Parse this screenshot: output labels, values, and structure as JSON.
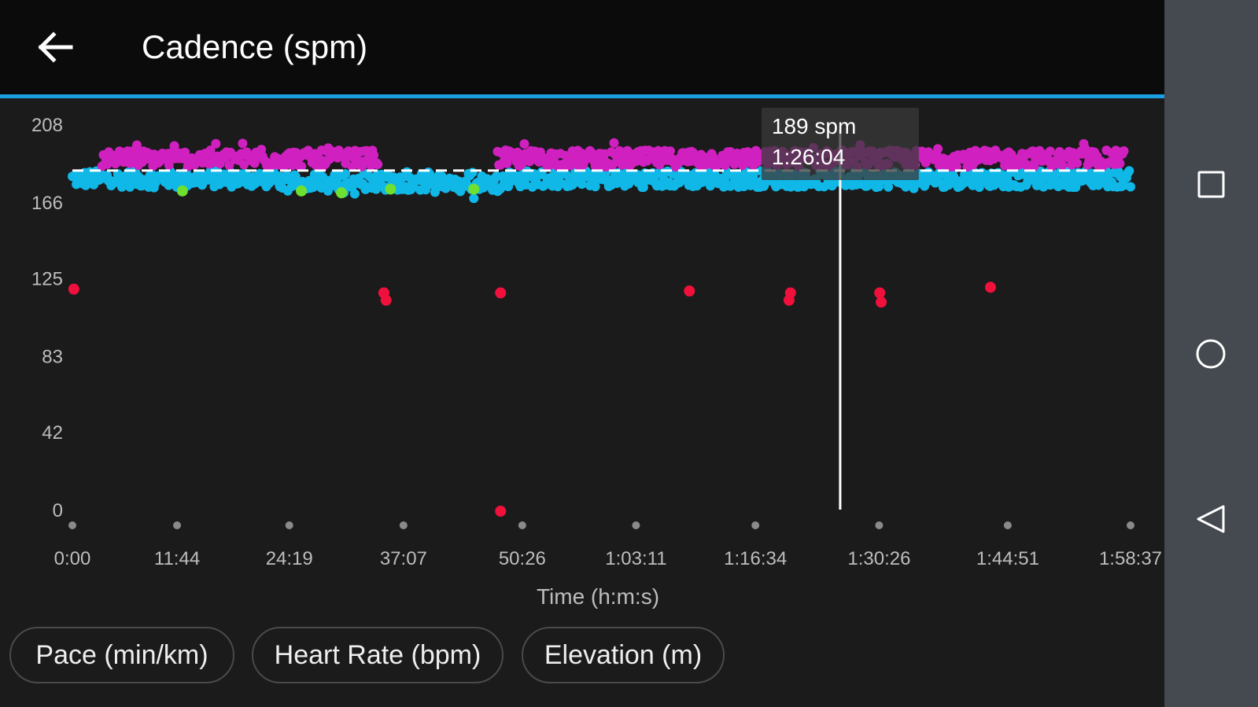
{
  "header": {
    "title": "Cadence (spm)",
    "back_icon": "arrow-left-icon"
  },
  "tooltip": {
    "value": "189 spm",
    "time": "1:26:04"
  },
  "buttons": [
    {
      "label": "Pace (min/km)"
    },
    {
      "label": "Heart Rate (bpm)"
    },
    {
      "label": "Elevation (m)"
    }
  ],
  "nav": {
    "recent_icon": "square-icon",
    "home_icon": "circle-icon",
    "back_icon": "triangle-back-icon",
    "background": "#444a4f"
  },
  "colors": {
    "header_bg": "#0b0b0b",
    "accent": "#1aa0e0",
    "magenta": "#d020c0",
    "cyan": "#10b8e8",
    "green": "#70e030",
    "red": "#f0103c"
  },
  "chart_data": {
    "type": "scatter",
    "title": "",
    "xlabel": "Time (h:m:s)",
    "ylabel": "",
    "xlim": [
      0,
      7117
    ],
    "ylim": [
      0,
      208
    ],
    "y_ticks": [
      208,
      166,
      125,
      83,
      42,
      0
    ],
    "x_ticks": [
      "0:00",
      "11:44",
      "24:19",
      "37:07",
      "50:26",
      "1:03:11",
      "1:16:34",
      "1:30:26",
      "1:44:51",
      "1:58:37"
    ],
    "x_tick_seconds": [
      0,
      704,
      1459,
      2227,
      3026,
      3791,
      4594,
      5426,
      6291,
      7117
    ],
    "average_line": 183,
    "cursor_time_seconds": 5164,
    "series": [
      {
        "color": "magenta",
        "range": [
          185,
          194
        ],
        "segments": [
          [
            200,
            2060
          ],
          [
            2860,
            7080
          ]
        ]
      },
      {
        "color": "cyan",
        "range": [
          174,
          183
        ],
        "segments": [
          [
            0,
            2860
          ],
          [
            2860,
            7117
          ]
        ]
      },
      {
        "color": "green",
        "points": [
          [
            740,
            172
          ],
          [
            1540,
            172
          ],
          [
            1810,
            171
          ],
          [
            2140,
            173
          ],
          [
            2700,
            173
          ]
        ]
      },
      {
        "color": "red",
        "points": [
          [
            10,
            119
          ],
          [
            2095,
            117
          ],
          [
            2110,
            113
          ],
          [
            2880,
            117
          ],
          [
            4150,
            118
          ],
          [
            4830,
            117
          ],
          [
            4820,
            113
          ],
          [
            5430,
            117
          ],
          [
            5440,
            112
          ],
          [
            6175,
            120
          ]
        ]
      }
    ]
  }
}
